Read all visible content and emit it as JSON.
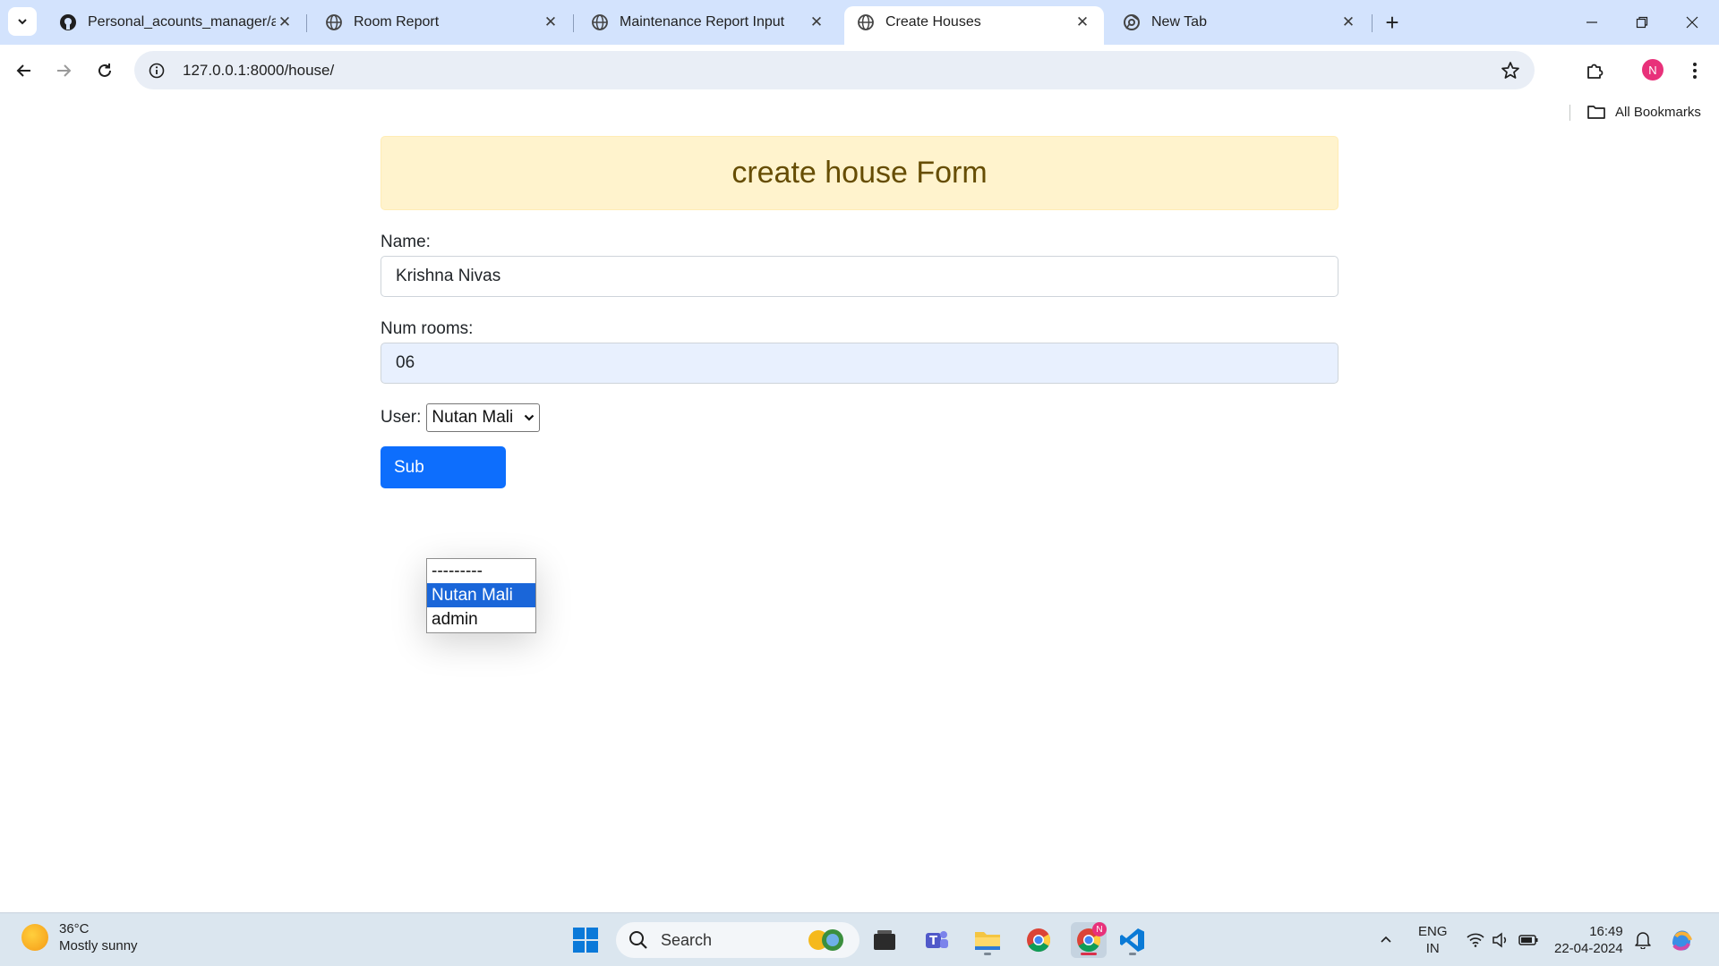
{
  "browser": {
    "tabs": [
      {
        "title": "Personal_acounts_manager/ap",
        "favicon": "github-icon",
        "active": false
      },
      {
        "title": "Room Report",
        "favicon": "globe-icon",
        "active": false
      },
      {
        "title": "Maintenance Report Input",
        "favicon": "globe-icon",
        "active": false
      },
      {
        "title": "Create Houses",
        "favicon": "globe-icon",
        "active": true
      },
      {
        "title": "New Tab",
        "favicon": "chrome-icon",
        "active": false
      }
    ],
    "url": "127.0.0.1:8000/house/",
    "profile_initial": "N",
    "bookmarks_label": "All Bookmarks"
  },
  "form": {
    "heading": "create house Form",
    "name_label": "Name:",
    "name_value": "Krishna Nivas",
    "rooms_label": "Num rooms:",
    "rooms_value": "06",
    "user_label": "User:",
    "user_selected": "Nutan Mali",
    "user_options": [
      "---------",
      "Nutan Mali",
      "admin"
    ],
    "submit_label": "Sub"
  },
  "taskbar": {
    "weather_temp": "36°C",
    "weather_desc": "Mostly sunny",
    "search_placeholder": "Search",
    "lang_top": "ENG",
    "lang_bottom": "IN",
    "time": "16:49",
    "date": "22-04-2024",
    "chrome_badge": "N"
  },
  "colors": {
    "tabstrip": "#d3e3fd",
    "alert_bg": "#fff3cd",
    "alert_text": "#664d03",
    "primary": "#0d6efd",
    "selected_option": "#1a66d9",
    "taskbar": "#dbe6ef"
  }
}
